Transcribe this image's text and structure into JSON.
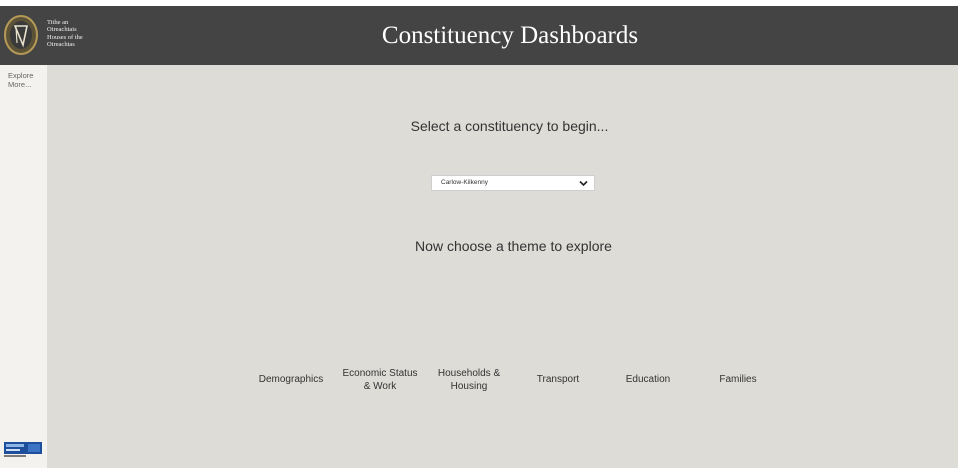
{
  "header": {
    "org_lines": [
      "Tithe an",
      "Oireachtais",
      "Houses of the",
      "Oireachtas"
    ],
    "title": "Constituency Dashboards",
    "logo_icon": "harp-icon"
  },
  "sidebar": {
    "explore_label": "Explore More..."
  },
  "main": {
    "prompt": "Select a constituency to begin...",
    "constituency_select": {
      "selected": "Carlow-Kilkenny"
    },
    "theme_prompt": "Now choose a theme to explore",
    "themes": [
      {
        "label": "Demographics"
      },
      {
        "label": "Economic Status & Work"
      },
      {
        "label": "Households & Housing"
      },
      {
        "label": "Transport"
      },
      {
        "label": "Education"
      },
      {
        "label": "Families"
      }
    ]
  },
  "colors": {
    "header_bg": "#444444",
    "main_bg": "#dedcd7",
    "sidebar_bg": "#f4f2ee",
    "logo_gold": "#b59a57"
  }
}
